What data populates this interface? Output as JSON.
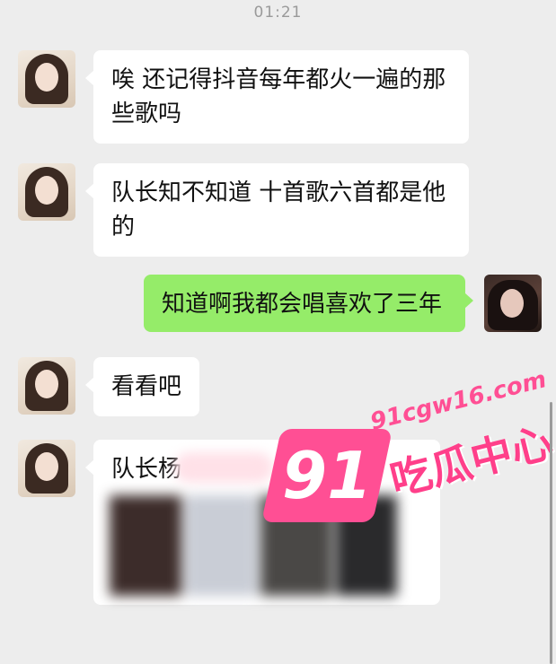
{
  "timestamp": "01:21",
  "messages": [
    {
      "from": "other",
      "text": "唉 还记得抖音每年都火一遍的那些歌吗"
    },
    {
      "from": "other",
      "text": "队长知不知道 十首歌六首都是他的"
    },
    {
      "from": "me",
      "text": "知道啊我都会唱喜欢了三年"
    },
    {
      "from": "other",
      "text": "看看吧"
    },
    {
      "from": "other",
      "text": "队长杨"
    }
  ],
  "watermark": {
    "number": "91",
    "url": "91cgw16.com",
    "name": "吃瓜中心",
    "color": "#ff4f94"
  },
  "colors": {
    "background": "#ededed",
    "incoming_bubble": "#ffffff",
    "outgoing_bubble": "#95ec69"
  }
}
